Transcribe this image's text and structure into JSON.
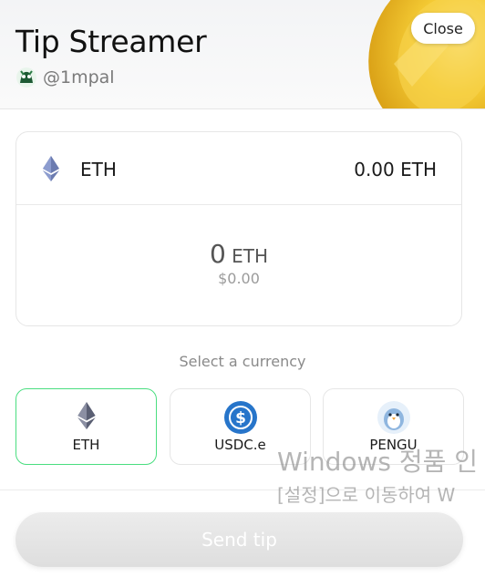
{
  "header": {
    "title": "Tip Streamer",
    "username": "@1mpal",
    "close_label": "Close"
  },
  "token_selector": {
    "token": "ETH",
    "balance": "0.00 ETH",
    "icon": "eth-icon"
  },
  "amount": {
    "value": "0",
    "unit": "ETH",
    "usd": "$0.00"
  },
  "currency_section": {
    "label": "Select a currency",
    "options": [
      {
        "label": "ETH",
        "icon": "eth-icon",
        "selected": true
      },
      {
        "label": "USDC.e",
        "icon": "usdc-icon",
        "selected": false
      },
      {
        "label": "PENGU",
        "icon": "pengu-icon",
        "selected": false
      }
    ]
  },
  "send_button": {
    "label": "Send tip",
    "enabled": false
  },
  "watermark": {
    "line1": "Windows 정품 인",
    "line2": "[설정]으로 이동하여 W"
  },
  "colors": {
    "selected_border": "#4ade80",
    "usdc_blue": "#2775ca",
    "coin_gold": "#f2c230"
  }
}
